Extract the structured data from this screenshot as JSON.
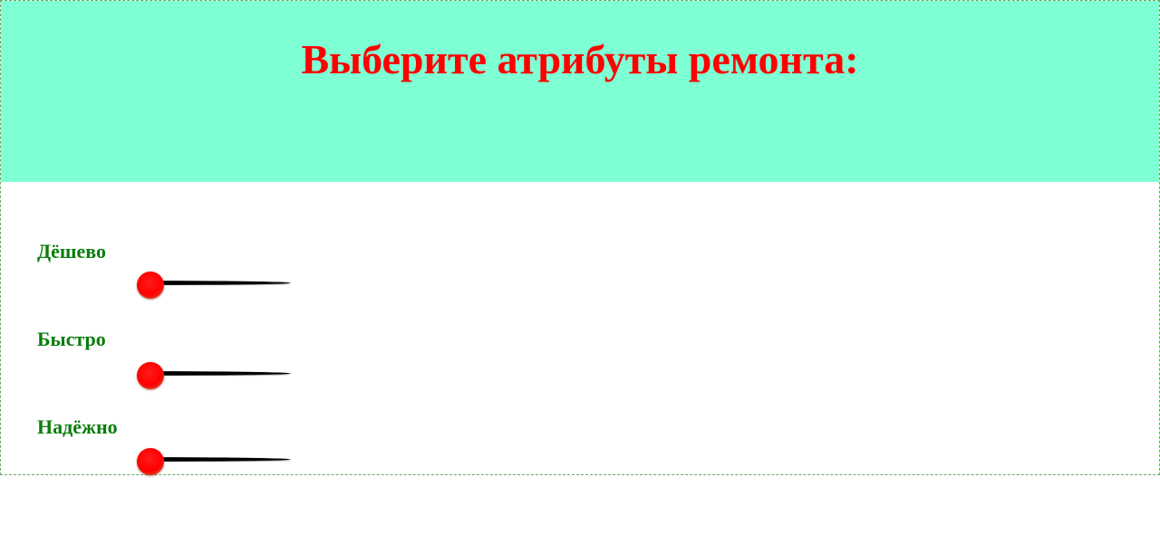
{
  "header": {
    "title": "Выберите атрибуты ремонта:",
    "background_color": "#7fffd4",
    "title_color": "#ff0000"
  },
  "controls": [
    {
      "label": "Дёшево",
      "value": 0
    },
    {
      "label": "Быстро",
      "value": 0
    },
    {
      "label": "Надёжно",
      "value": 0
    }
  ],
  "colors": {
    "label": "#0b7d0b",
    "thumb": "#ff0000",
    "track": "#000000"
  }
}
